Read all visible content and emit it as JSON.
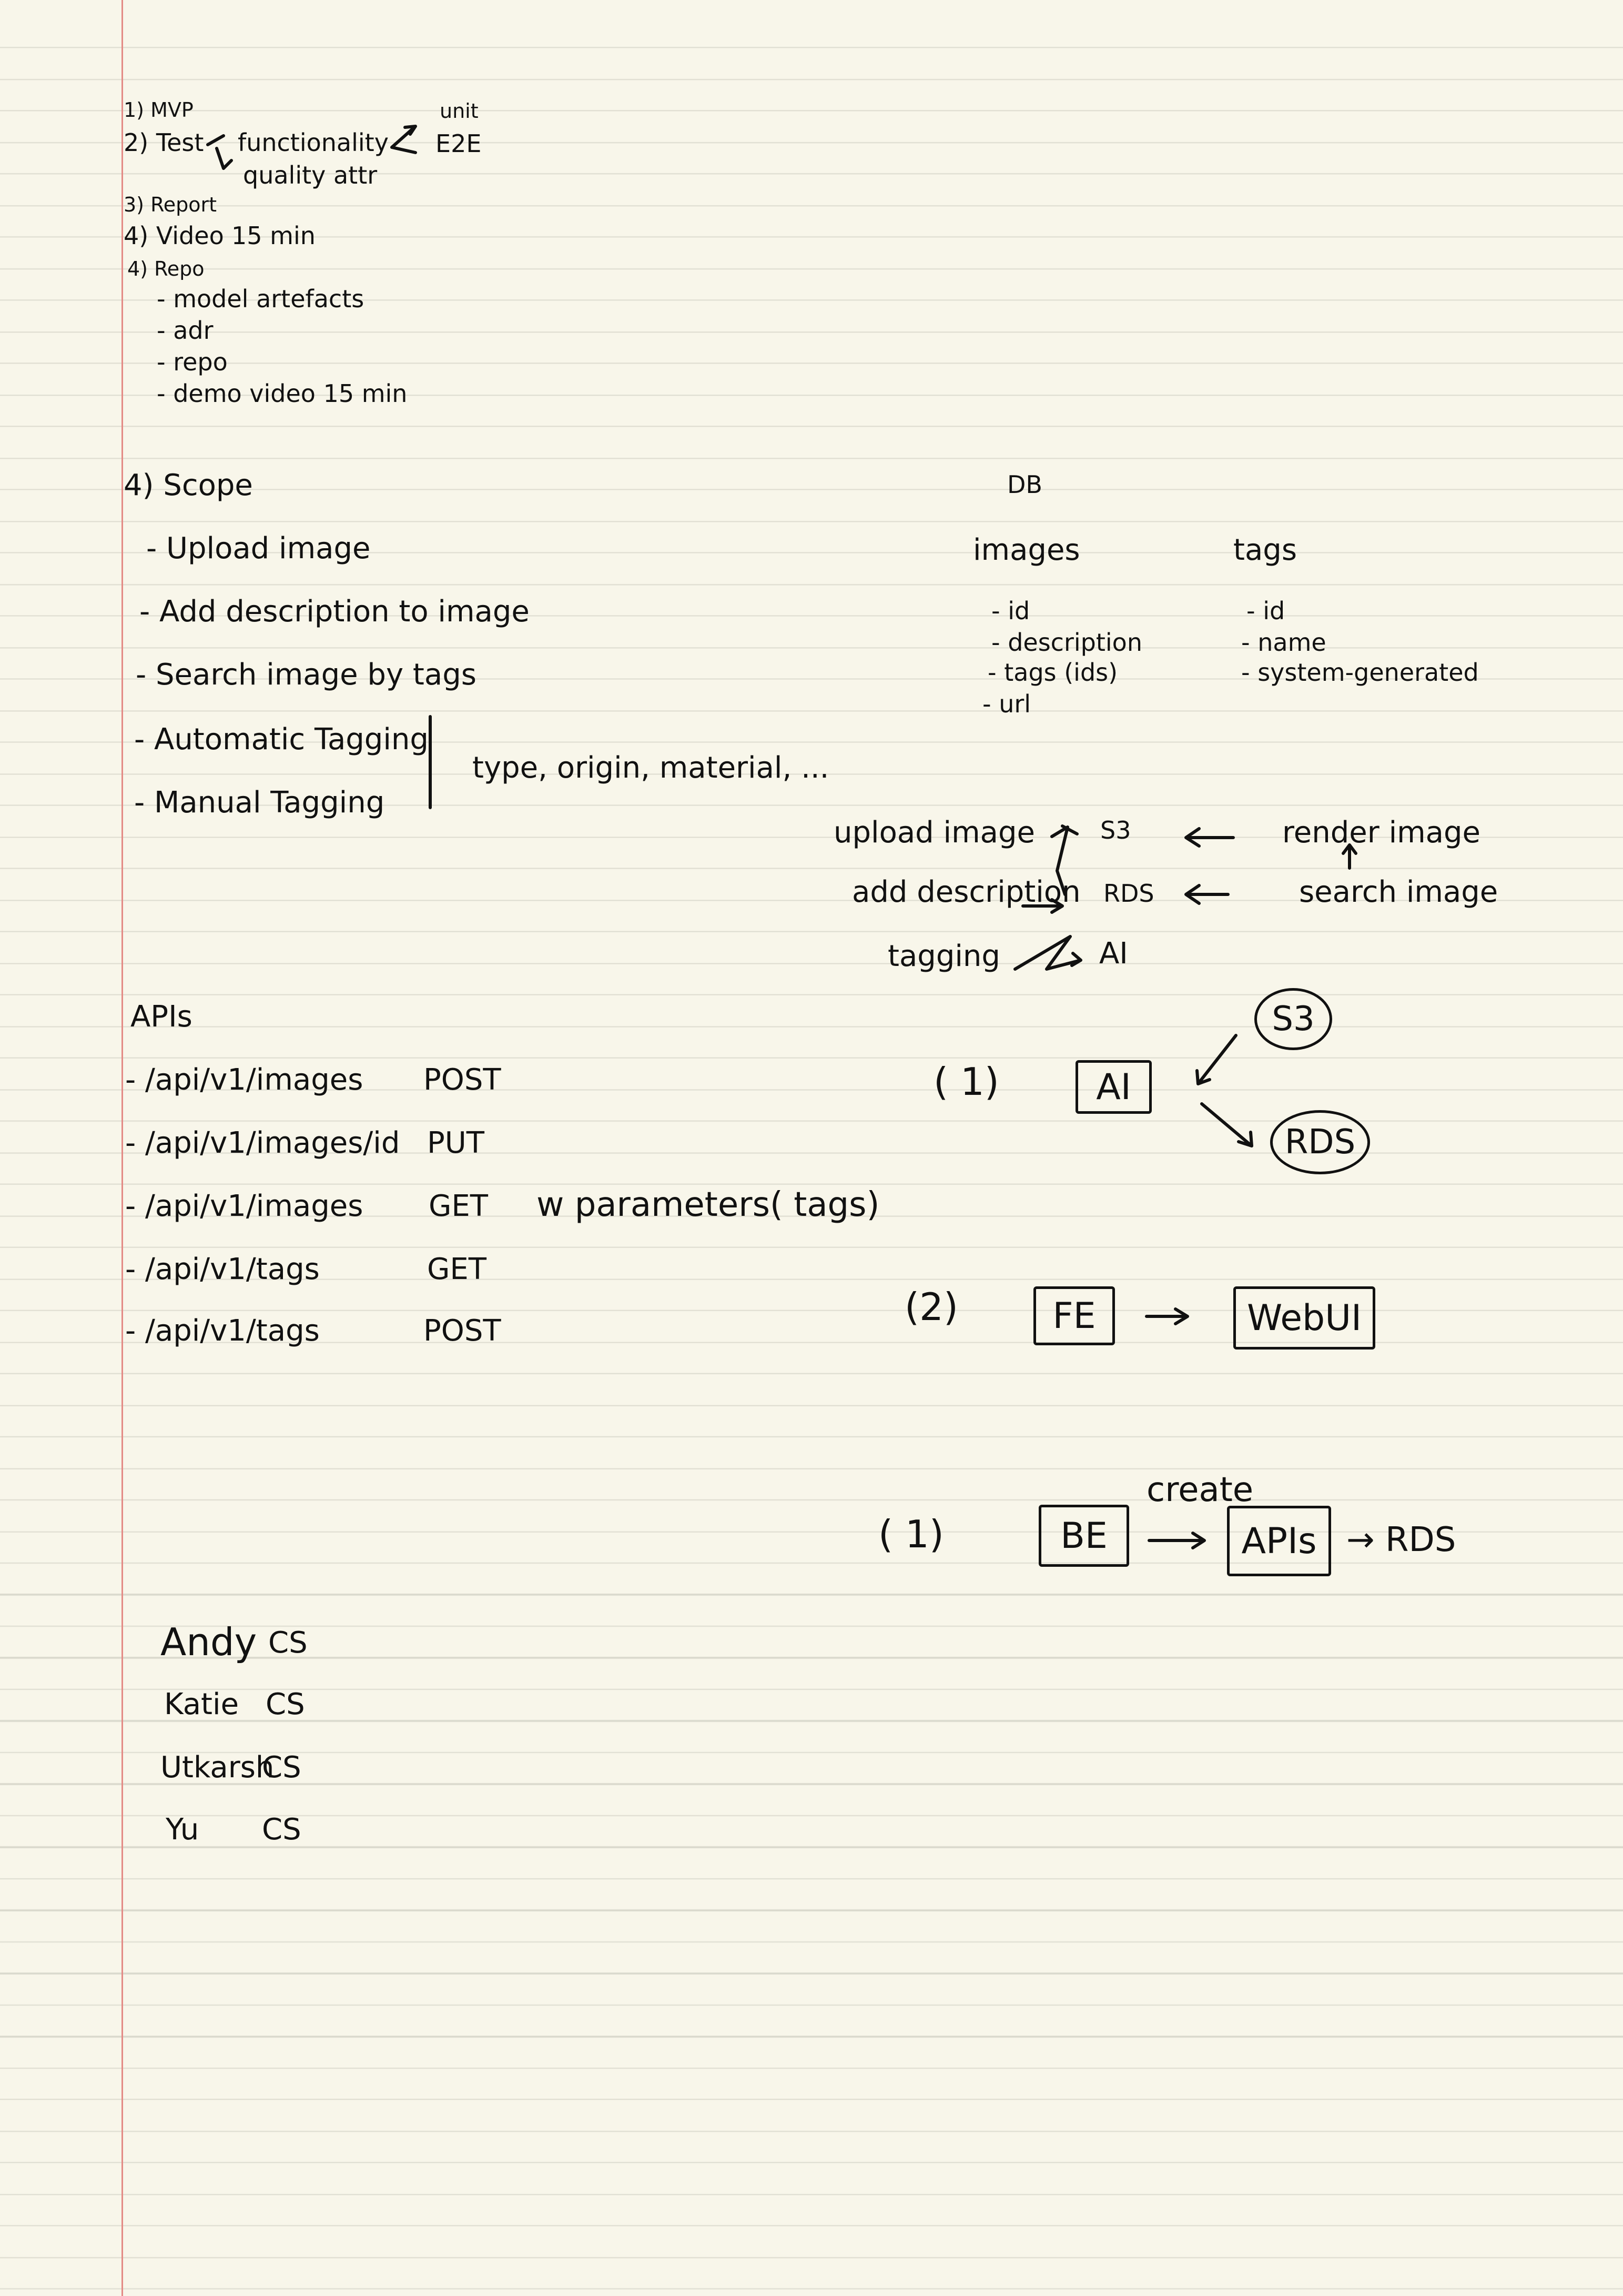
{
  "deliverables": {
    "item1": "1) MVP",
    "item2": "2) Test",
    "test_func": "functionality",
    "test_quality": "quality attr",
    "test_unit": "unit",
    "test_e2e": "E2E",
    "item3": "3) Report",
    "item4_video": "4) Video",
    "video_duration": "15 min",
    "item4_repo": "4) Repo",
    "repo_items": [
      "- model artefacts",
      "- adr",
      "- repo",
      "- demo video   15 min"
    ]
  },
  "scope": {
    "heading": "4) Scope",
    "items": [
      "- Upload image",
      "- Add description to image",
      "- Search image by tags",
      "- Automatic Tagging",
      "- Manual Tagging"
    ],
    "tag_types": "type, origin, material, ..."
  },
  "db": {
    "heading": "DB",
    "images_title": "images",
    "images_fields": [
      "- id",
      "- description",
      "- tags (ids)",
      "- url"
    ],
    "tags_title": "tags",
    "tags_fields": [
      "- id",
      "- name",
      "- system-generated"
    ]
  },
  "flow": {
    "upload_image": "upload   image",
    "add_description": "add description",
    "tagging": "tagging",
    "s3": "S3",
    "rds": "RDS",
    "ai": "AI",
    "render_image": "render image",
    "search_image": "search   image"
  },
  "apis": {
    "heading": "APIs",
    "rows": [
      {
        "path": "- /api/v1/images",
        "method": "POST",
        "note": ""
      },
      {
        "path": "- /api/v1/images/id",
        "method": "PUT",
        "note": ""
      },
      {
        "path": "- /api/v1/images",
        "method": "GET",
        "note": "w parameters( tags)"
      },
      {
        "path": "- /api/v1/tags",
        "method": "GET",
        "note": ""
      },
      {
        "path": "- /api/v1/tags",
        "method": "POST",
        "note": ""
      }
    ]
  },
  "arch": {
    "d1_label": "( 1)",
    "d1_ai": "AI",
    "d1_s3": "S3",
    "d1_rds": "RDS",
    "d2_label": "(2)",
    "d2_fe": "FE",
    "d2_webui": "WebUI",
    "d3_label": "( 1)",
    "d3_be": "BE",
    "d3_create": "create",
    "d3_apis": "APIs",
    "d3_rds": "→ RDS"
  },
  "team": [
    {
      "name": "Andy",
      "role": "CS"
    },
    {
      "name": "Katie",
      "role": "CS"
    },
    {
      "name": "Utkarsh",
      "role": "CS"
    },
    {
      "name": "Yu",
      "role": "CS"
    }
  ],
  "colors": {
    "paper": "#f8f6ea",
    "ruled_line": "#d9d8cc",
    "margin_line": "#e38b86",
    "ink": "#111111"
  }
}
